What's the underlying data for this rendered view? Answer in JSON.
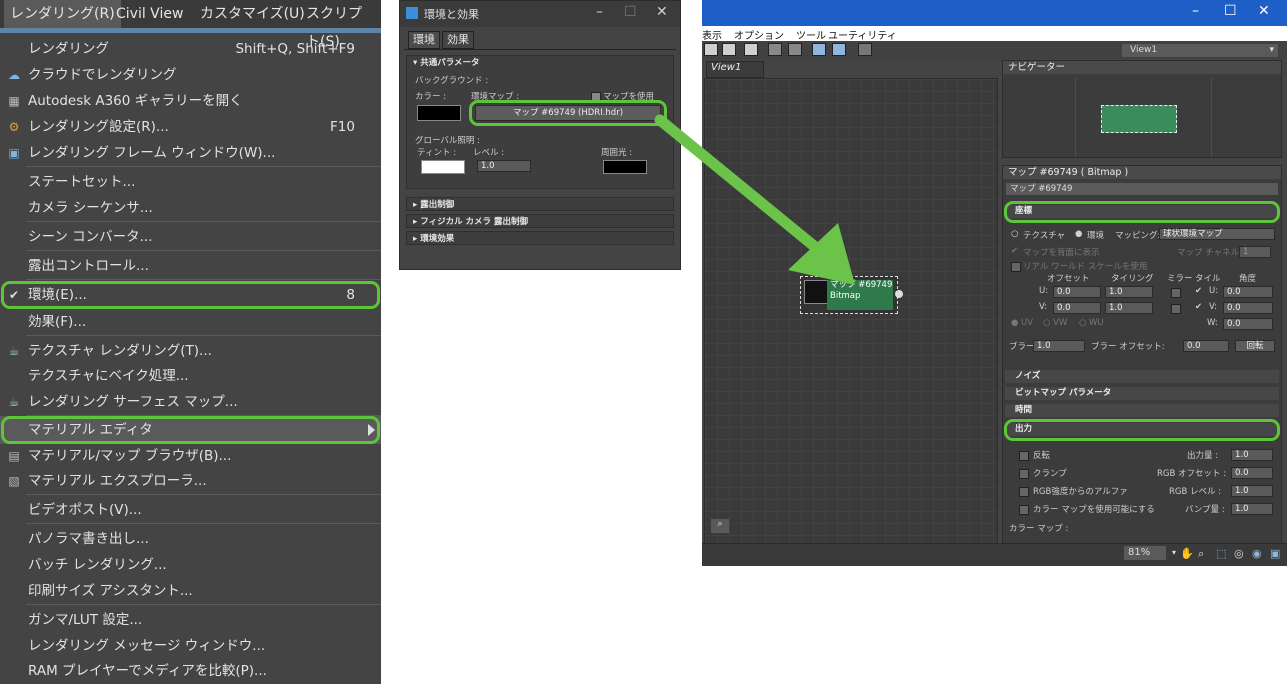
{
  "menubar": {
    "items": [
      "レンダリング(R)",
      "Civil View",
      "カスタマイズ(U)",
      "スクリプト(S)"
    ]
  },
  "menu": {
    "items": [
      {
        "label": "レンダリング",
        "shortcut": "Shift+Q, Shift+F9"
      },
      {
        "label": "クラウドでレンダリング"
      },
      {
        "label": "Autodesk A360 ギャラリーを開く"
      },
      {
        "label": "レンダリング設定(R)...",
        "shortcut": "F10"
      },
      {
        "label": "レンダリング フレーム ウィンドウ(W)..."
      },
      {
        "label": "ステートセット..."
      },
      {
        "label": "カメラ シーケンサ..."
      },
      {
        "label": "シーン コンバータ..."
      },
      {
        "label": "露出コントロール..."
      },
      {
        "label": "環境(E)...",
        "shortcut": "8"
      },
      {
        "label": "効果(F)..."
      },
      {
        "label": "テクスチャ レンダリング(T)..."
      },
      {
        "label": "テクスチャにベイク処理..."
      },
      {
        "label": "レンダリング サーフェス マップ..."
      },
      {
        "label": "マテリアル エディタ"
      },
      {
        "label": "マテリアル/マップ ブラウザ(B)..."
      },
      {
        "label": "マテリアル エクスプローラ..."
      },
      {
        "label": "ビデオポスト(V)..."
      },
      {
        "label": "パノラマ書き出し..."
      },
      {
        "label": "バッチ レンダリング..."
      },
      {
        "label": "印刷サイズ アシスタント..."
      },
      {
        "label": "ガンマ/LUT 設定..."
      },
      {
        "label": "レンダリング メッセージ ウィンドウ..."
      },
      {
        "label": "RAM プレイヤーでメディアを比較(P)..."
      }
    ]
  },
  "env_dialog": {
    "title": "環境と効果",
    "tabs": [
      "環境",
      "効果"
    ],
    "common_params": "共通パラメータ",
    "background": "バックグラウンド :",
    "color_label": "カラー :",
    "env_map_label": "環境マップ :",
    "use_map": "マップを使用",
    "map_button": "マップ #69749 (HDRI.hdr)",
    "global_light": "グローバル照明 :",
    "tint": "ティント :",
    "level": "レベル :",
    "ambient": "周囲光 :",
    "level_value": "1.0",
    "rollouts": [
      "露出制御",
      "フィジカル カメラ 露出制御",
      "環境効果"
    ]
  },
  "slate": {
    "menu": [
      "表示",
      "オプション",
      "ツール",
      "ユーティリティ"
    ],
    "view_select": "View1",
    "view_tab": "View1",
    "navigator": "ナビゲーター",
    "node_title": "マップ #69749",
    "node_type": "Bitmap",
    "map_panel_title": "マップ #69749 ( Bitmap )",
    "map_name": "マップ #69749",
    "coords": "座標",
    "texture": "テクスチャ",
    "environ": "環境",
    "mapping_label": "マッピング:",
    "mapping_value": "球状環境マップ",
    "show_map_back": "マップを背面に表示",
    "map_channel": "マップ チャネル:",
    "map_channel_value": "1",
    "real_world": "リアル ワールド スケールを使用",
    "offset": "オフセット",
    "tiling": "タイリング",
    "mirror": "ミラー",
    "tile": "タイル",
    "angle": "角度",
    "u_label": "U:",
    "v_label": "V:",
    "w_label": "W:",
    "u_offset": "0.0",
    "u_tiling": "1.0",
    "u_angle": "0.0",
    "v_offset": "0.0",
    "v_tiling": "1.0",
    "v_angle": "0.0",
    "w_angle": "0.0",
    "uv": "UV",
    "vw": "VW",
    "wu": "WU",
    "blur": "ブラー:",
    "blur_value": "1.0",
    "blur_offset": "ブラー オフセット:",
    "blur_offset_value": "0.0",
    "rotate": "回転",
    "noise": "ノイズ",
    "bitmap_params": "ビットマップ パラメータ",
    "time": "時間",
    "output": "出力",
    "invert": "反転",
    "clamp": "クランプ",
    "alpha_from_rgb": "RGB強度からのアルファ",
    "enable_color_map": "カラー マップを使用可能にする",
    "output_amount": "出力量 :",
    "output_amount_value": "1.0",
    "rgb_offset": "RGB オフセット :",
    "rgb_offset_value": "0.0",
    "rgb_level": "RGB レベル :",
    "rgb_level_value": "1.0",
    "bump_amount": "バンプ量 :",
    "bump_amount_value": "1.0",
    "color_map": "カラー マップ :",
    "zoom": "81%"
  },
  "colors": {
    "highlight": "#5ec43a",
    "arrow": "#6cc34a",
    "node": "#2e7a4a",
    "titlebar": "#1d5fc7"
  }
}
